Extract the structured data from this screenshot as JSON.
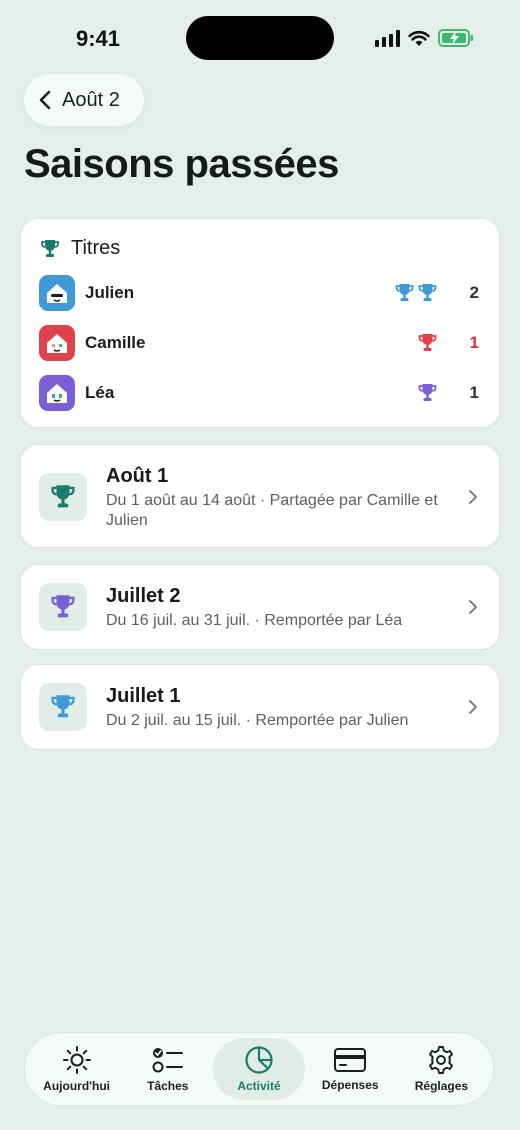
{
  "status_bar": {
    "time": "9:41"
  },
  "nav": {
    "back_label": "Août 2"
  },
  "page_title": "Saisons passées",
  "titles_card": {
    "heading": "Titres",
    "rows": [
      {
        "name": "Julien",
        "count": "2",
        "trophy_color": "#3e99d6",
        "trophies": 2,
        "avatar_color": "#3e99d6",
        "count_color": "#333333"
      },
      {
        "name": "Camille",
        "count": "1",
        "trophy_color": "#e0424d",
        "trophies": 1,
        "avatar_color": "#e0424d",
        "count_color": "#d9323d"
      },
      {
        "name": "Léa",
        "count": "1",
        "trophy_color": "#7a5fd6",
        "trophies": 1,
        "avatar_color": "#7a5fd6",
        "count_color": "#333333"
      }
    ]
  },
  "seasons": [
    {
      "title": "Août 1",
      "subtitle": "Du 1 août au 14 août · Partagée par Camille et Julien",
      "trophy_color": "#1a7d6c"
    },
    {
      "title": "Juillet 2",
      "subtitle": "Du 16 juil. au 31 juil. · Remportée par Léa",
      "trophy_color": "#7a5fd6"
    },
    {
      "title": "Juillet 1",
      "subtitle": "Du 2 juil. au 15 juil. · Remportée par Julien",
      "trophy_color": "#3e99d6"
    }
  ],
  "tabs": [
    {
      "label": "Aujourd'hui",
      "icon": "sun-icon"
    },
    {
      "label": "Tâches",
      "icon": "checklist-icon"
    },
    {
      "label": "Activité",
      "icon": "pie-chart-icon",
      "active": true
    },
    {
      "label": "Dépenses",
      "icon": "credit-card-icon"
    },
    {
      "label": "Réglages",
      "icon": "gear-icon"
    }
  ],
  "colors": {
    "accent": "#1a7d6c",
    "background": "#e4efea"
  }
}
